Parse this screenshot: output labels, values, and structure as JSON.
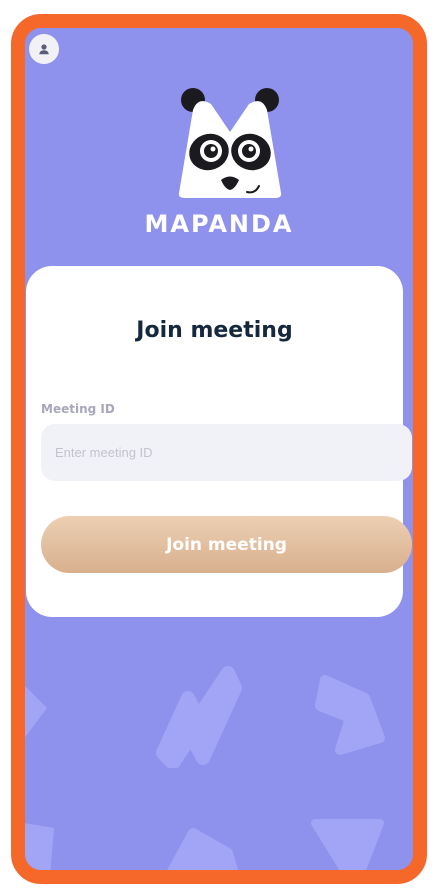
{
  "app": {
    "brand_name": "MAPANDA"
  },
  "join_card": {
    "title": "Join meeting",
    "meeting_id_label": "Meeting ID",
    "meeting_id_placeholder": "Enter meeting ID",
    "meeting_id_value": "",
    "join_button_label": "Join meeting"
  },
  "colors": {
    "frame_border": "#f5682a",
    "background": "#8f92ec",
    "card": "#ffffff",
    "title_text": "#15283c",
    "button_gradient_top": "#edcfb3",
    "button_gradient_bottom": "#d8b08e"
  },
  "icons": {
    "avatar": "user-icon",
    "logo": "panda-logo-icon"
  }
}
